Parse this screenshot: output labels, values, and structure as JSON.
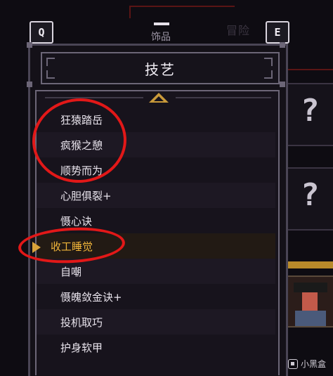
{
  "header": {
    "left_key": "Q",
    "right_key": "E",
    "category": "饰品",
    "background_label": "冒险"
  },
  "panel": {
    "title": "技艺"
  },
  "skills": [
    {
      "label": "狂猿踏岳",
      "circled": true
    },
    {
      "label": "疯猴之憩",
      "circled": true
    },
    {
      "label": "顺势而为",
      "circled": true
    },
    {
      "label": "心胆俱裂+"
    },
    {
      "label": "慑心诀"
    },
    {
      "label": "收工睡觉",
      "selected": true,
      "circled": true
    },
    {
      "label": "自嘲"
    },
    {
      "label": "慑魄敛金诀+"
    },
    {
      "label": "投机取巧"
    },
    {
      "label": "护身软甲"
    }
  ],
  "side_slots": [
    {
      "symbol": "?"
    },
    {
      "symbol": "?"
    }
  ],
  "watermark": "小黑盒",
  "colors": {
    "selected_text": "#f0b53a",
    "annotation_red": "#e21818",
    "accent_gold": "#c99a3a"
  }
}
